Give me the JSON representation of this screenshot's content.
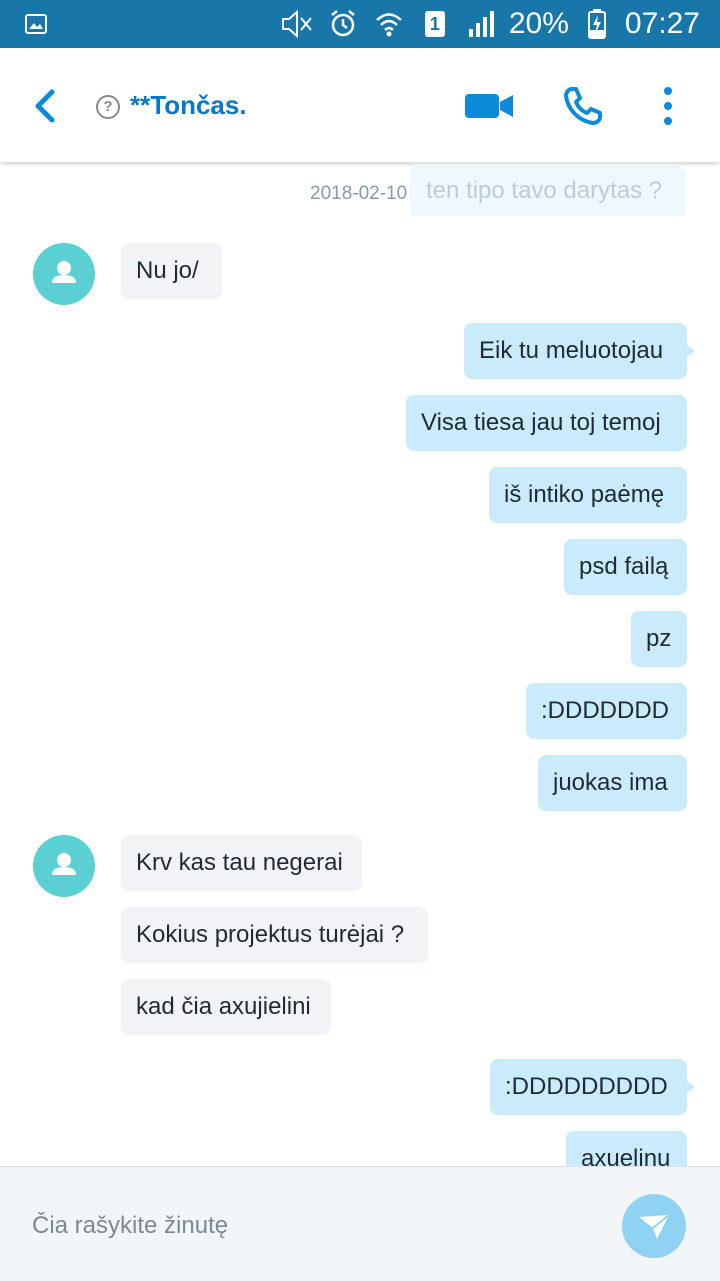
{
  "status_bar": {
    "battery": "20%",
    "time": "07:27",
    "sim_slot": "1",
    "icons": [
      "gallery-icon",
      "mute-icon",
      "alarm-icon",
      "wifi-icon",
      "sim-icon",
      "signal-icon",
      "battery-charging-icon"
    ]
  },
  "header": {
    "contact_name": "**Tončas.",
    "help_glyph": "?",
    "icons": [
      "back-arrow-icon",
      "help-icon",
      "video-call-icon",
      "phone-icon",
      "more-vert-icon"
    ]
  },
  "chat": {
    "date_label": "2018-02-10",
    "faded_message": "ten tipo tavo darytas ?",
    "messages": [
      {
        "text": "Nu jo/",
        "direction": "incoming"
      },
      {
        "text": "Eik tu meluotojau",
        "direction": "outgoing"
      },
      {
        "text": "Visa tiesa jau toj temoj",
        "direction": "outgoing"
      },
      {
        "text": "iš intiko paėmę",
        "direction": "outgoing"
      },
      {
        "text": "psd failą",
        "direction": "outgoing"
      },
      {
        "text": "pz",
        "direction": "outgoing"
      },
      {
        "text": ":DDDDDDD",
        "direction": "outgoing"
      },
      {
        "text": "juokas ima",
        "direction": "outgoing"
      },
      {
        "text": "Krv kas tau negerai",
        "direction": "incoming"
      },
      {
        "text": "Kokius projektus turėjai ?",
        "direction": "incoming"
      },
      {
        "text": "kad čia axujielini",
        "direction": "incoming"
      },
      {
        "text": ":DDDDDDDDD",
        "direction": "outgoing"
      },
      {
        "text": "axuelinu",
        "direction": "outgoing"
      }
    ]
  },
  "composer": {
    "placeholder": "Čia rašykite žinutę"
  },
  "colors": {
    "status_bar": "#1976a8",
    "accent": "#0a78c8",
    "outgoing_bubble": "#c9ebfb",
    "incoming_bubble": "#f1f3f6",
    "avatar": "#5ad0d2",
    "send_button": "#8fd2f2"
  }
}
